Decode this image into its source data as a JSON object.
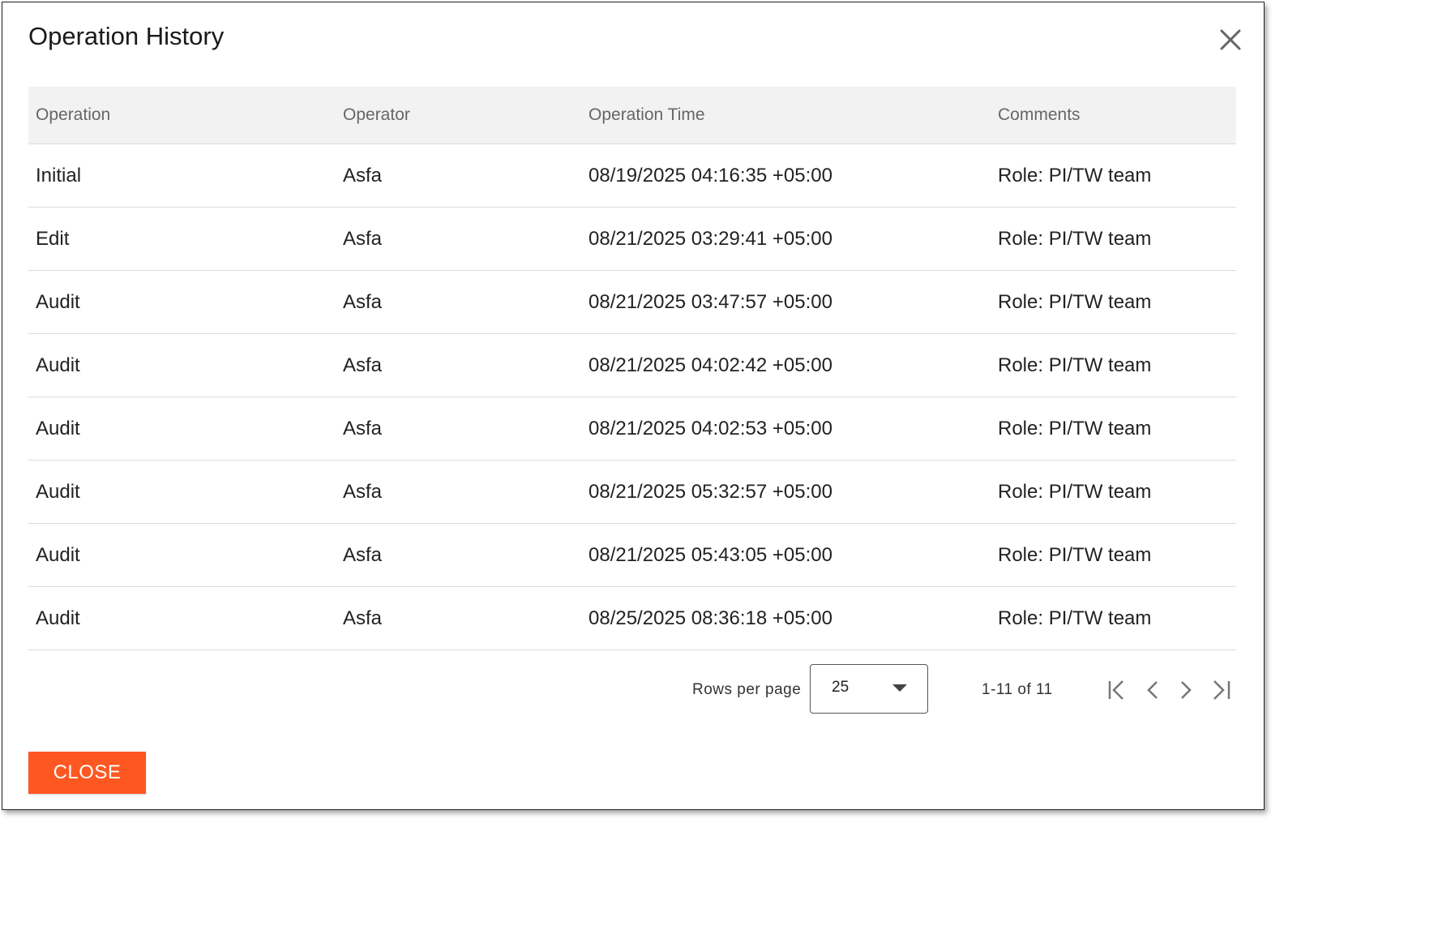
{
  "dialog": {
    "title": "Operation History",
    "close_icon": "close-icon"
  },
  "table": {
    "columns": [
      "Operation",
      "Operator",
      "Operation Time",
      "Comments"
    ],
    "rows": [
      [
        "Initial",
        "Asfa",
        "08/19/2025 04:16:35 +05:00",
        "Role: PI/TW team"
      ],
      [
        "Edit",
        "Asfa",
        "08/21/2025 03:29:41 +05:00",
        "Role: PI/TW team"
      ],
      [
        "Audit",
        "Asfa",
        "08/21/2025 03:47:57 +05:00",
        "Role: PI/TW team"
      ],
      [
        "Audit",
        "Asfa",
        "08/21/2025 04:02:42 +05:00",
        "Role: PI/TW team"
      ],
      [
        "Audit",
        "Asfa",
        "08/21/2025 04:02:53 +05:00",
        "Role: PI/TW team"
      ],
      [
        "Audit",
        "Asfa",
        "08/21/2025 05:32:57 +05:00",
        "Role: PI/TW team"
      ],
      [
        "Audit",
        "Asfa",
        "08/21/2025 05:43:05 +05:00",
        "Role: PI/TW team"
      ],
      [
        "Audit",
        "Asfa",
        "08/25/2025 08:36:18 +05:00",
        "Role: PI/TW team"
      ]
    ]
  },
  "pagination": {
    "rows_per_page_label": "Rows per page",
    "rows_per_page_value": "25",
    "range_label": "1-11 of 11",
    "icons": [
      "first-page-icon",
      "previous-page-icon",
      "next-page-icon",
      "last-page-icon"
    ]
  },
  "footer": {
    "close_label": "CLOSE",
    "close_color": "#fe5722"
  }
}
